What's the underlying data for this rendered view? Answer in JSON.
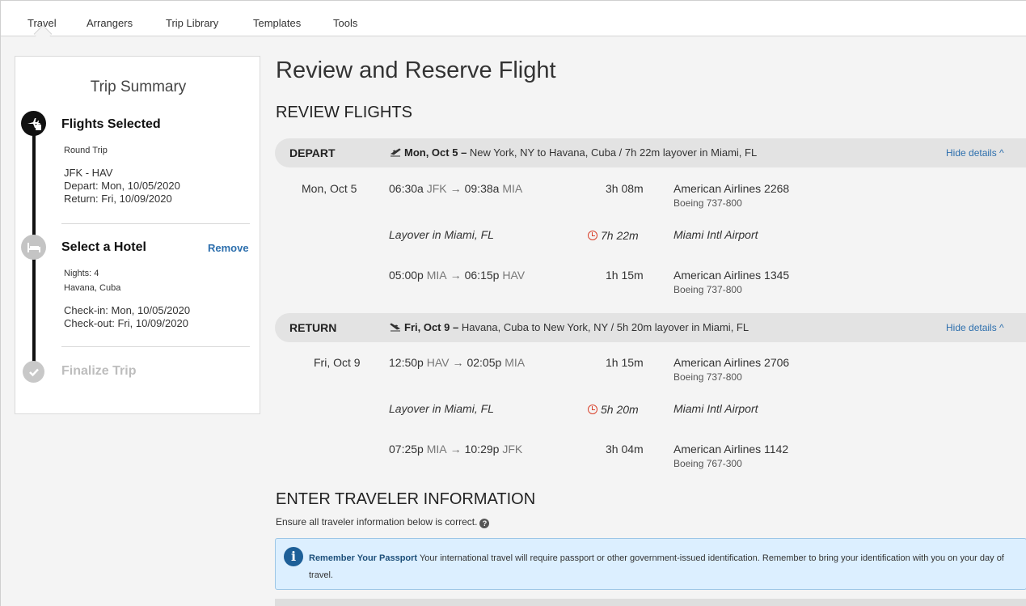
{
  "nav": {
    "tabs": [
      {
        "label": "Travel",
        "active": true
      },
      {
        "label": "Arrangers"
      },
      {
        "label": "Trip Library"
      },
      {
        "label": "Templates"
      },
      {
        "label": "Tools"
      }
    ]
  },
  "sidebar": {
    "title": "Trip Summary",
    "steps": [
      {
        "title": "Flights Selected",
        "icon": "plane-bag-icon",
        "trip_type": "Round Trip",
        "route": "JFK - HAV",
        "depart": "Depart: Mon, 10/05/2020",
        "return": "Return: Fri, 10/09/2020"
      },
      {
        "title": "Select a Hotel",
        "icon": "bed-icon",
        "action": "Remove",
        "nights": "Nights: 4",
        "city": "Havana, Cuba",
        "checkin": "Check-in: Mon, 10/05/2020",
        "checkout": "Check-out: Fri, 10/09/2020"
      },
      {
        "title": "Finalize Trip",
        "icon": "check-icon"
      }
    ]
  },
  "main": {
    "page_title": "Review and Reserve Flight",
    "review_title": "REVIEW FLIGHTS",
    "depart": {
      "label": "DEPART",
      "date": "Mon, Oct 5",
      "dash": " – ",
      "summary": "New York, NY to Havana, Cuba / 7h 22m layover in Miami, FL",
      "hide": "Hide details ^",
      "row_date": "Mon, Oct 5",
      "leg1": {
        "dep_time": "06:30a",
        "dep_code": "JFK",
        "arr_time": "09:38a",
        "arr_code": "MIA",
        "duration": "3h 08m",
        "airline": "American Airlines 2268",
        "aircraft": "Boeing 737-800"
      },
      "layover": {
        "text": "Layover in Miami, FL",
        "duration": "7h 22m",
        "airport": "Miami Intl Airport"
      },
      "leg2": {
        "dep_time": "05:00p",
        "dep_code": "MIA",
        "arr_time": "06:15p",
        "arr_code": "HAV",
        "duration": "1h 15m",
        "airline": "American Airlines 1345",
        "aircraft": "Boeing 737-800"
      }
    },
    "return": {
      "label": "RETURN",
      "date": "Fri, Oct 9",
      "dash": " – ",
      "summary": "Havana, Cuba to New York, NY  / 5h 20m layover in Miami, FL",
      "hide": "Hide details ^",
      "row_date": "Fri, Oct 9",
      "leg1": {
        "dep_time": "12:50p",
        "dep_code": "HAV",
        "arr_time": "02:05p",
        "arr_code": "MIA",
        "duration": "1h 15m",
        "airline": "American Airlines 2706",
        "aircraft": "Boeing 737-800"
      },
      "layover": {
        "text": "Layover in Miami, FL",
        "duration": "5h 20m",
        "airport": "Miami Intl Airport"
      },
      "leg2": {
        "dep_time": "07:25p",
        "dep_code": "MIA",
        "arr_time": "10:29p",
        "arr_code": "JFK",
        "duration": "3h 04m",
        "airline": "American Airlines 1142",
        "aircraft": "Boeing 767-300"
      }
    },
    "traveler_title": "ENTER TRAVELER INFORMATION",
    "traveler_note": "Ensure all traveler information below is correct.",
    "info": {
      "bold": "Remember Your Passport",
      "text": " Your international travel will require passport or other government-issued identification. Remember to bring your identification with you on your day of travel."
    }
  }
}
